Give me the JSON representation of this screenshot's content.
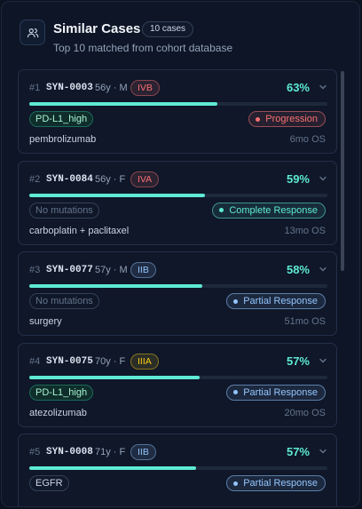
{
  "header": {
    "icon": "users-icon",
    "title": "Similar Cases",
    "count_badge": "10 cases",
    "subtitle": "Top 10 matched from cohort database"
  },
  "cases": [
    {
      "rank": "#1",
      "id": "SYN-0003",
      "demographics": "56y · M",
      "stage": "IVB",
      "stage_color": "#f87171",
      "match_pct": "63%",
      "match_fraction": 0.63,
      "marker": "PD-L1_high",
      "marker_style": "mut",
      "response": "Progression",
      "response_color": "#f87171",
      "treatment": "pembrolizumab",
      "os": "6mo OS"
    },
    {
      "rank": "#2",
      "id": "SYN-0084",
      "demographics": "56y · F",
      "stage": "IVA",
      "stage_color": "#f87171",
      "match_pct": "59%",
      "match_fraction": 0.59,
      "marker": "No mutations",
      "marker_style": "none",
      "response": "Complete Response",
      "response_color": "#5eead4",
      "treatment": "carboplatin + paclitaxel",
      "os": "13mo OS"
    },
    {
      "rank": "#3",
      "id": "SYN-0077",
      "demographics": "57y · M",
      "stage": "IIB",
      "stage_color": "#93c5fd",
      "match_pct": "58%",
      "match_fraction": 0.58,
      "marker": "No mutations",
      "marker_style": "none",
      "response": "Partial Response",
      "response_color": "#93c5fd",
      "treatment": "surgery",
      "os": "51mo OS"
    },
    {
      "rank": "#4",
      "id": "SYN-0075",
      "demographics": "70y · F",
      "stage": "IIIA",
      "stage_color": "#facc15",
      "match_pct": "57%",
      "match_fraction": 0.57,
      "marker": "PD-L1_high",
      "marker_style": "mut",
      "response": "Partial Response",
      "response_color": "#93c5fd",
      "treatment": "atezolizumab",
      "os": "20mo OS"
    },
    {
      "rank": "#5",
      "id": "SYN-0008",
      "demographics": "71y · F",
      "stage": "IIB",
      "stage_color": "#93c5fd",
      "match_pct": "57%",
      "match_fraction": 0.56,
      "marker": "EGFR",
      "marker_style": "gene",
      "response": "Partial Response",
      "response_color": "#93c5fd",
      "treatment": "",
      "os": ""
    }
  ]
}
